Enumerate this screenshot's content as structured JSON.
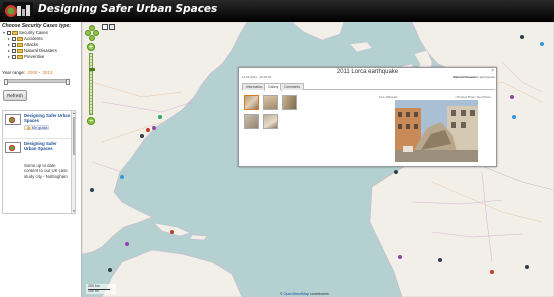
{
  "header": {
    "title": "Designing Safer Urban Spaces",
    "bg_color": "#000000"
  },
  "sidebar": {
    "choose_label": "Choose Security Cases type:",
    "tree": [
      {
        "label": "Security Cases",
        "level": 1,
        "toggle": "▾"
      },
      {
        "label": "Accidents",
        "level": 2,
        "toggle": "▸"
      },
      {
        "label": "Attacks",
        "level": 2,
        "toggle": "▸"
      },
      {
        "label": "Natural Disasters",
        "level": 2,
        "toggle": "▸"
      },
      {
        "label": "Preventive",
        "level": 2,
        "toggle": "▸"
      }
    ],
    "year_range_label": "Year range:",
    "year_from": "2000",
    "year_to": "2013",
    "refresh_label": "Refresh",
    "feed": [
      {
        "title": "Designing Safer Urban Spaces",
        "like_label": "👍 Me gusta"
      },
      {
        "title": "Designing Safer Urban Spaces",
        "description": "Some up to date content to our UK case study city - Nottingham"
      }
    ]
  },
  "map": {
    "zoom_in": "+",
    "zoom_out": "−",
    "scale_top": "200 km",
    "scale_bottom": "100 mi",
    "attribution_prefix": "© ",
    "attribution_link": "OpenStreetMap",
    "attribution_suffix": " contributors"
  },
  "popup": {
    "title": "2011 Lorca earthquake",
    "close": "×",
    "date": "11-05-2011 · 00:00:00",
    "category_label": "Natural Disasters",
    "category_value": "Earthquake",
    "tabs": [
      "Information",
      "Gallery",
      "Comments"
    ],
    "active_tab": "Gallery",
    "caption_left": "Foto: Wikipedia",
    "caption_right": "‹ Previous Photo | Next Photo ›"
  },
  "colors": {
    "accent": "#e07a20",
    "sea": "#b5d0d0",
    "land": "#f2efe9",
    "link": "#1b4f96",
    "zoom": "#8cc63f"
  }
}
